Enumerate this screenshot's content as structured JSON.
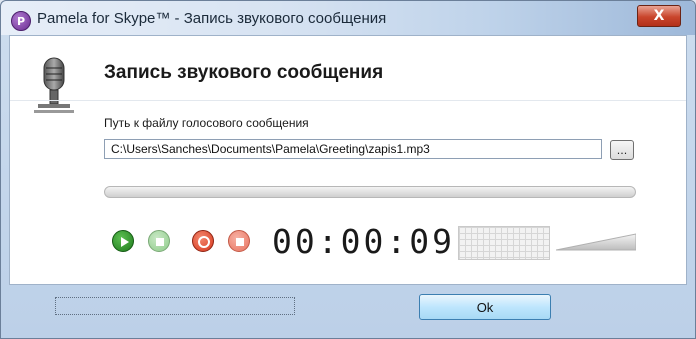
{
  "window": {
    "title": "Pamela for Skype™ - Запись звукового сообщения",
    "app_icon_letter": "P",
    "close_label": "X"
  },
  "header": {
    "title": "Запись звукового сообщения",
    "icon": "microphone-icon"
  },
  "form": {
    "path_label": "Путь к файлу голосового сообщения",
    "path_value": "C:\\Users\\Sanches\\Documents\\Pamela\\Greeting\\zapis1.mp3",
    "browse_label": "..."
  },
  "player": {
    "timer": "00:00:09",
    "controls": [
      "play-icon",
      "stop-icon",
      "record-icon",
      "stop-record-icon"
    ]
  },
  "footer": {
    "ok_label": "Ok"
  },
  "colors": {
    "accent": "#3c7fb1",
    "play": "#1e7b1c",
    "record": "#d7361c"
  }
}
